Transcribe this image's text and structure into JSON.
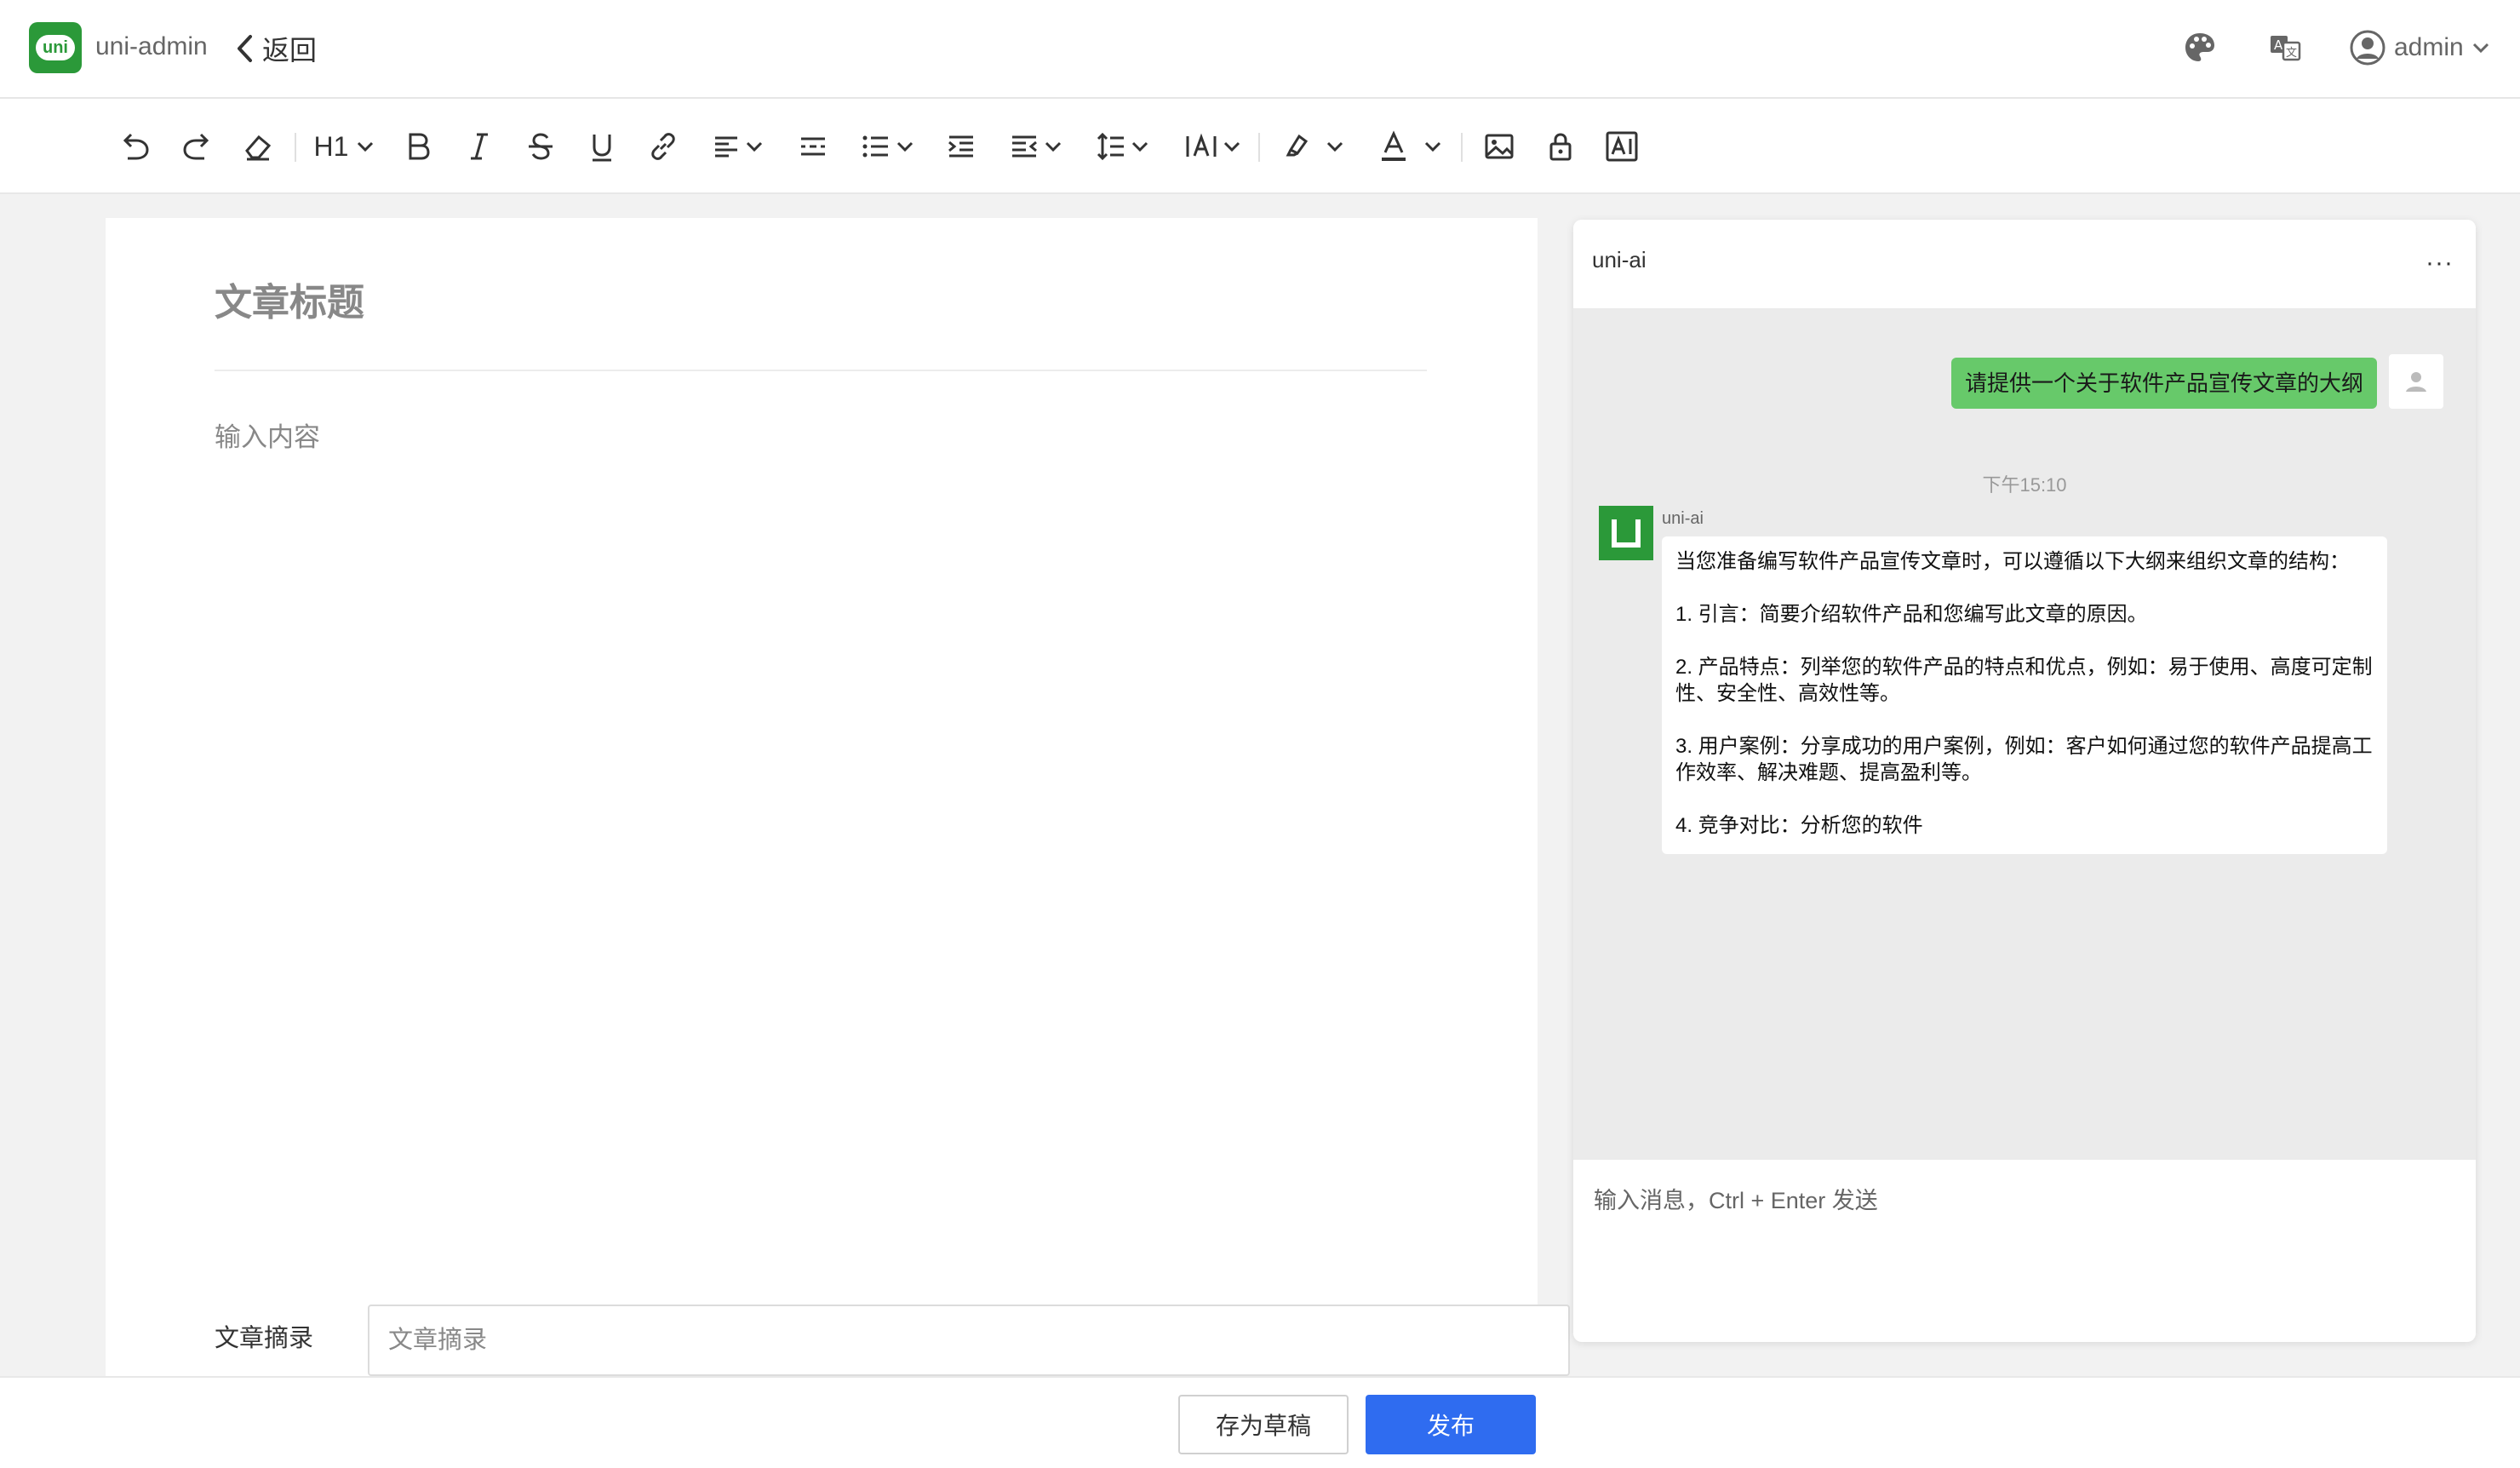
{
  "header": {
    "logo_text": "uni",
    "app_name": "uni-admin",
    "back_label": "返回",
    "user_name": "admin",
    "icons": [
      "palette-icon",
      "translate-icon",
      "user-avatar-icon",
      "chevron-down-icon"
    ]
  },
  "toolbar": {
    "heading_level": "H1",
    "tools": [
      "undo-icon",
      "redo-icon",
      "eraser-icon",
      "heading-dropdown",
      "bold-icon",
      "italic-icon",
      "strikethrough-icon",
      "underline-icon",
      "link-icon",
      "align-dropdown",
      "divider-icon",
      "list-dropdown",
      "indent-icon",
      "outdent-dropdown",
      "line-height-dropdown",
      "letter-spacing-dropdown",
      "highlight-dropdown",
      "font-color-dropdown",
      "image-icon",
      "lock-icon",
      "ai-icon"
    ]
  },
  "editor": {
    "title_placeholder": "文章标题",
    "content_placeholder": "输入内容",
    "excerpt_label": "文章摘录",
    "excerpt_placeholder": "文章摘录"
  },
  "chat": {
    "title": "uni-ai",
    "more_label": "···",
    "user_message": "请提供一个关于软件产品宣传文章的大纲",
    "timestamp": "下午15:10",
    "ai_name": "uni-ai",
    "ai_paragraphs": [
      "当您准备编写软件产品宣传文章时，可以遵循以下大纲来组织文章的结构：",
      "1. 引言：简要介绍软件产品和您编写此文章的原因。",
      "2. 产品特点：列举您的软件产品的特点和优点，例如：易于使用、高度可定制性、安全性、高效性等。",
      "3. 用户案例：分享成功的用户案例，例如：客户如何通过您的软件产品提高工作效率、解决难题、提高盈利等。",
      "4. 竞争对比：分析您的软件"
    ],
    "input_placeholder": "输入消息，Ctrl + Enter 发送"
  },
  "footer": {
    "draft_label": "存为草稿",
    "publish_label": "发布"
  },
  "colors": {
    "brand_green": "#2b9939",
    "user_bubble": "#67c96a",
    "primary_blue": "#2f6cf0"
  }
}
